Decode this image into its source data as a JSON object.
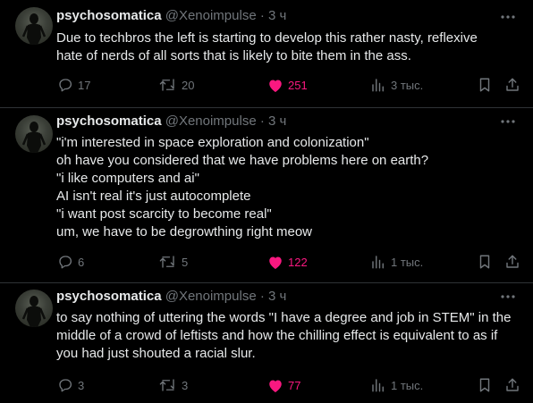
{
  "colors": {
    "background": "#000000",
    "text": "#e7e9ea",
    "muted": "#71767b",
    "like": "#f91880",
    "divider": "#2f3336"
  },
  "tweets": [
    {
      "author_name": "psychosomatica",
      "author_handle": "@Xenoimpulse",
      "separator": "·",
      "time": "3 ч",
      "lines": [
        "Due to techbros the left is starting to develop this rather nasty, reflexive",
        "hate of nerds of all sorts that is likely to bite them in the ass."
      ],
      "replies": "17",
      "retweets": "20",
      "likes": "251",
      "views": "3 тыс.",
      "liked": true
    },
    {
      "author_name": "psychosomatica",
      "author_handle": "@Xenoimpulse",
      "separator": "·",
      "time": "3 ч",
      "lines": [
        "\"i'm interested in space exploration and colonization\"",
        "oh have you considered that we have problems here on earth?",
        "\"i like computers and ai\"",
        "AI isn't real it's just autocomplete",
        "\"i want post scarcity to become real\"",
        "um, we have to be degrowthing right meow"
      ],
      "replies": "6",
      "retweets": "5",
      "likes": "122",
      "views": "1 тыс.",
      "liked": true
    },
    {
      "author_name": "psychosomatica",
      "author_handle": "@Xenoimpulse",
      "separator": "·",
      "time": "3 ч",
      "lines": [
        "to say nothing of uttering the words \"I have a degree and job in STEM\" in the",
        "middle of a crowd of leftists and how the chilling effect is equivalent to as if",
        "you had just shouted a racial slur."
      ],
      "replies": "3",
      "retweets": "3",
      "likes": "77",
      "views": "1 тыс.",
      "liked": true
    }
  ],
  "icons": {
    "avatar": "avatar-figure-icon",
    "more": "more-dots-icon",
    "reply": "reply-icon",
    "retweet": "retweet-icon",
    "like": "heart-icon",
    "views": "views-chart-icon",
    "bookmark": "bookmark-icon",
    "share": "share-icon"
  }
}
